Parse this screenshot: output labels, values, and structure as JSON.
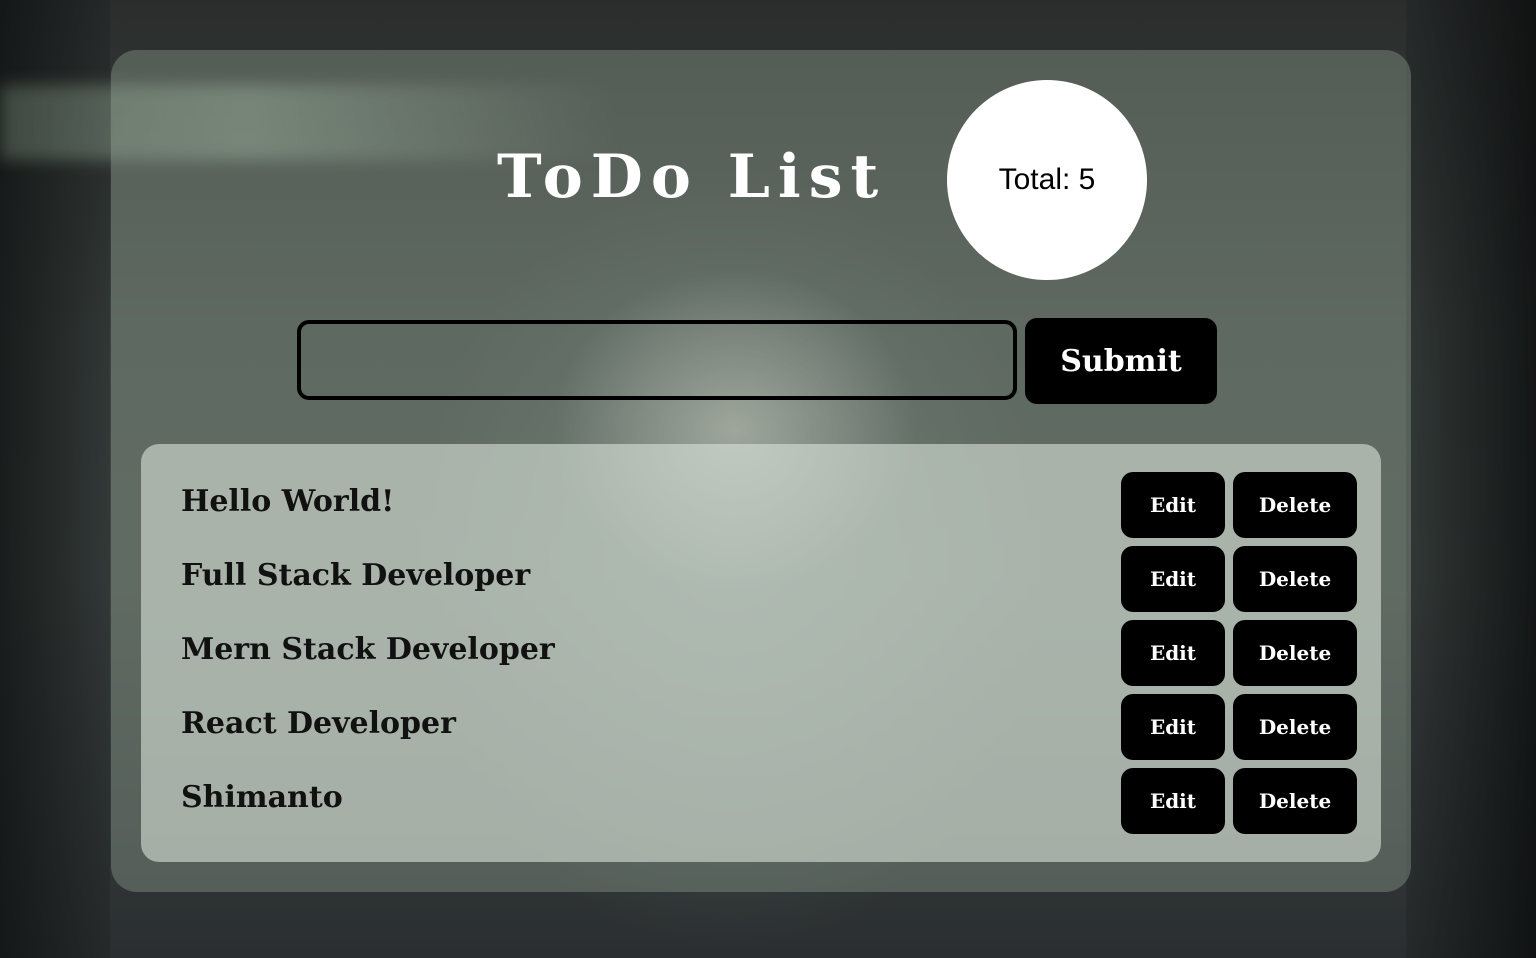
{
  "app": {
    "title": "ToDo List",
    "counter_label": "Total: 5"
  },
  "form": {
    "input_value": "",
    "submit_label": "Submit"
  },
  "todos": [
    {
      "text": "Hello World!",
      "edit_label": "Edit",
      "delete_label": "Delete"
    },
    {
      "text": "Full Stack Developer",
      "edit_label": "Edit",
      "delete_label": "Delete"
    },
    {
      "text": "Mern Stack Developer",
      "edit_label": "Edit",
      "delete_label": "Delete"
    },
    {
      "text": "React Developer",
      "edit_label": "Edit",
      "delete_label": "Delete"
    },
    {
      "text": "Shimanto",
      "edit_label": "Edit",
      "delete_label": "Delete"
    }
  ],
  "colors": {
    "button_bg": "#000000",
    "button_text": "#ffffff",
    "title_text": "#ffffff",
    "counter_bg": "#ffffff"
  }
}
